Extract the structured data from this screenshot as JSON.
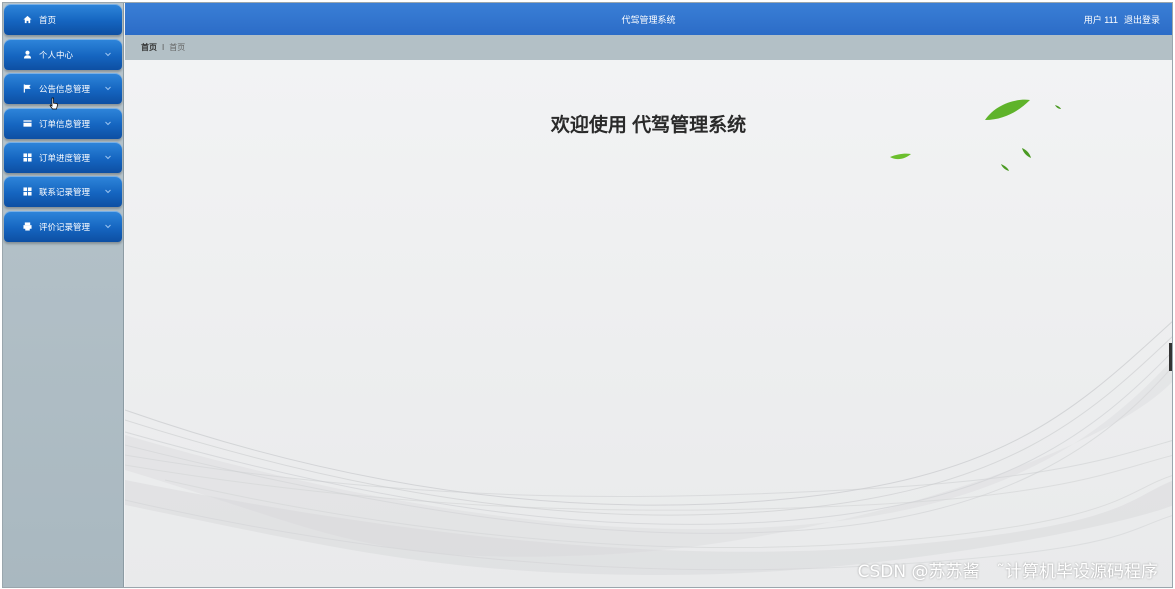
{
  "header": {
    "title": "代驾管理系统",
    "user_label": "用户 111",
    "logout_label": "退出登录"
  },
  "sidebar": {
    "items": [
      {
        "label": "首页",
        "icon": "home-icon",
        "has_submenu": false
      },
      {
        "label": "个人中心",
        "icon": "user-icon",
        "has_submenu": true
      },
      {
        "label": "公告信息管理",
        "icon": "flag-icon",
        "has_submenu": true
      },
      {
        "label": "订单信息管理",
        "icon": "card-icon",
        "has_submenu": true
      },
      {
        "label": "订单进度管理",
        "icon": "grid-icon",
        "has_submenu": true
      },
      {
        "label": "联系记录管理",
        "icon": "grid-icon",
        "has_submenu": true
      },
      {
        "label": "评价记录管理",
        "icon": "printer-icon",
        "has_submenu": true
      }
    ]
  },
  "breadcrumb": {
    "home": "首页",
    "separator": "I",
    "current": "首页"
  },
  "main": {
    "welcome": "欢迎使用 代驾管理系统"
  },
  "watermark": "CSDN @苏苏酱　˜计算机毕设源码程序",
  "colors": {
    "menu_blue": "#1565c0",
    "header_blue": "#2c6cc7",
    "sidebar_bg": "#b3c0c6",
    "leaf_green": "#5fb32a"
  }
}
